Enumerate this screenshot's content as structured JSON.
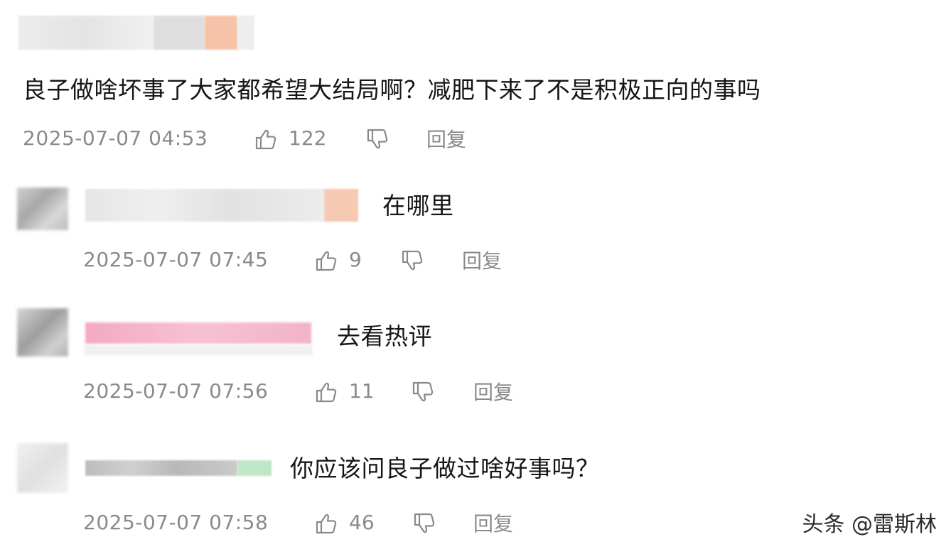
{
  "comments": [
    {
      "text": "良子做啥坏事了大家都希望大结局啊？减肥下来了不是积极正向的事吗",
      "timestamp": "2025-07-07 04:53",
      "likes": "122",
      "reply_label": "回复"
    },
    {
      "text": "在哪里",
      "timestamp": "2025-07-07 07:45",
      "likes": "9",
      "reply_label": "回复"
    },
    {
      "text": "去看热评",
      "timestamp": "2025-07-07 07:56",
      "likes": "11",
      "reply_label": "回复"
    },
    {
      "text": "你应该问良子做过啥好事吗？",
      "timestamp": "2025-07-07 07:58",
      "likes": "46",
      "reply_label": "回复"
    }
  ],
  "watermark": "头条 @雷斯林",
  "icons": {
    "like": "thumbs-up-icon",
    "dislike": "thumbs-down-icon"
  },
  "colors": {
    "meta_text": "#8a8a8a",
    "body_text": "#161616",
    "blur_pink": "#f7c6d6",
    "blur_peach": "#f6c9b2",
    "blur_green": "#bfe6c6"
  }
}
